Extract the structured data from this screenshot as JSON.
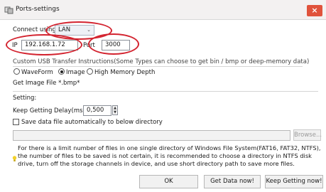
{
  "window": {
    "title": "Ports-settings",
    "close_label": "×"
  },
  "connect": {
    "label": "Connect using",
    "value": "LAN"
  },
  "ip": {
    "label": "IP",
    "value": "192.168.1.72"
  },
  "port": {
    "label": "Port",
    "value": "3000"
  },
  "custom_usb": {
    "label": "Custom USB Transfer Instructions(Some Types can choose to get bin / bmp or deep-memory data)",
    "options": [
      "WaveForm",
      "Image",
      "High Memory Depth"
    ],
    "selected": "Image",
    "info": "Get Image File *.bmp*"
  },
  "setting": {
    "label": "Setting:",
    "delay_label": "Keep Getting Delay(ms):",
    "delay_value": "0,500",
    "save_label": "Save data file automatically to below directory",
    "save_checked": false,
    "directory_value": "",
    "browse_label": "Browse..."
  },
  "note": {
    "text": "For there is a limit number of files in one single directory of Windows File System(FAT16, FAT32, NTFS), the number of  files to be saved is not certain,  it is recommended to choose a directory in NTFS disk drive, turn off the storage channels in device, and use short directory path to save more files."
  },
  "buttons": {
    "ok": "OK",
    "get_data": "Get Data now!",
    "keep_getting": "Keep Getting now!"
  },
  "colors": {
    "annotation": "#d3232f",
    "close_button": "#e0533c",
    "titlebar": "#f3f1f1"
  }
}
